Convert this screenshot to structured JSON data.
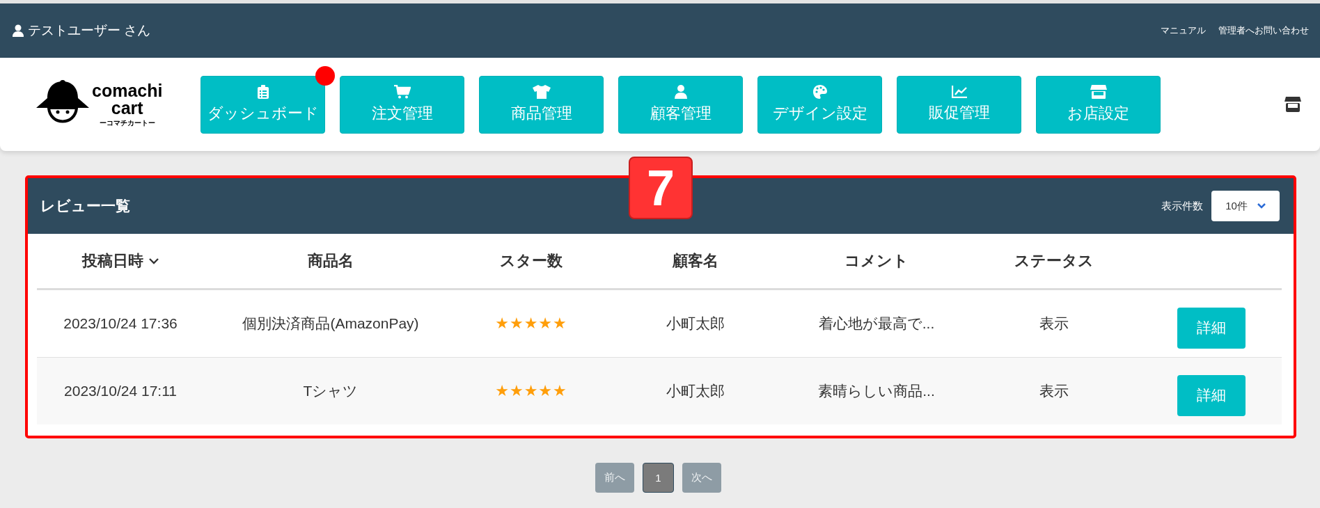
{
  "top_bar": {
    "user": "テストユーザー さん",
    "links": [
      "マニュアル",
      "管理者へお問い合わせ"
    ]
  },
  "logo": {
    "name_line1": "comachi",
    "name_line2": "cart",
    "tagline": "ーコマチカートー"
  },
  "nav": [
    {
      "label": "ダッシュボード",
      "notification": true
    },
    {
      "label": "注文管理",
      "notification": false
    },
    {
      "label": "商品管理",
      "notification": false
    },
    {
      "label": "顧客管理",
      "notification": false
    },
    {
      "label": "デザイン設定",
      "notification": false
    },
    {
      "label": "販促管理",
      "notification": false
    },
    {
      "label": "お店設定",
      "notification": false
    }
  ],
  "callout_badge": "7",
  "panel": {
    "title": "レビュー一覧",
    "per_page_label": "表示件数",
    "per_page_value": "10件"
  },
  "table": {
    "columns": [
      {
        "label": "投稿日時",
        "sorted": true
      },
      {
        "label": "商品名",
        "sorted": false
      },
      {
        "label": "スター数",
        "sorted": false
      },
      {
        "label": "顧客名",
        "sorted": false
      },
      {
        "label": "コメント",
        "sorted": false
      },
      {
        "label": "ステータス",
        "sorted": false
      }
    ],
    "rows": [
      {
        "date": "2023/10/24 17:36",
        "product": "個別決済商品(AmazonPay)",
        "stars": 5,
        "customer": "小町太郎",
        "comment": "着心地が最高で...",
        "status": "表示",
        "action": "詳細"
      },
      {
        "date": "2023/10/24 17:11",
        "product": "Tシャツ",
        "stars": 5,
        "customer": "小町太郎",
        "comment": "素晴らしい商品...",
        "status": "表示",
        "action": "詳細"
      }
    ]
  },
  "pagination": {
    "prev": {
      "label": "前へ",
      "disabled": true
    },
    "pages": [
      {
        "label": "1",
        "selected": true
      }
    ],
    "next": {
      "label": "次へ",
      "disabled": true
    }
  }
}
